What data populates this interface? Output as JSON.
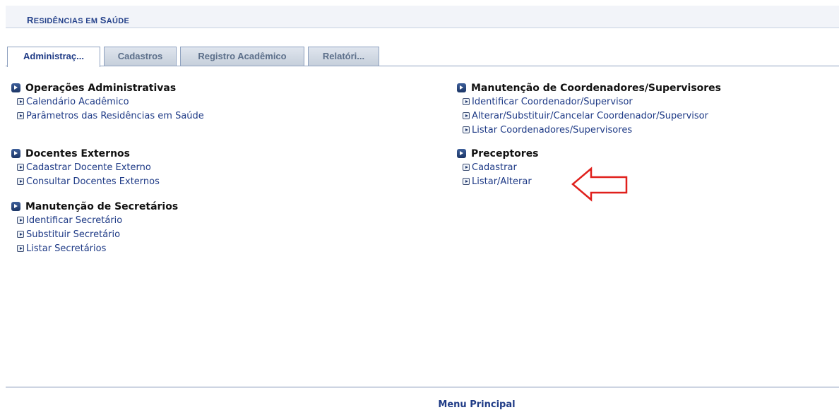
{
  "header": {
    "title_parts": [
      {
        "t": "R",
        "big": true
      },
      {
        "t": "ESIDÊNCIAS EM ",
        "big": false
      },
      {
        "t": "S",
        "big": true
      },
      {
        "t": "AÚDE",
        "big": false
      }
    ]
  },
  "tabs": [
    {
      "label": "Administraç...",
      "active": true
    },
    {
      "label": "Cadastros",
      "active": false
    },
    {
      "label": "Registro Acadêmico",
      "active": false
    },
    {
      "label": "Relatóri...",
      "active": false
    }
  ],
  "sections": {
    "operacoes": {
      "title": "Operações Administrativas",
      "items": [
        "Calendário Acadêmico",
        "Parâmetros das Residências em Saúde"
      ]
    },
    "docentes": {
      "title": "Docentes Externos",
      "items": [
        "Cadastrar Docente Externo",
        "Consultar Docentes Externos"
      ]
    },
    "secretarios": {
      "title": "Manutenção de Secretários",
      "items": [
        "Identificar Secretário",
        "Substituir Secretário",
        "Listar Secretários"
      ]
    },
    "coordenadores": {
      "title": "Manutenção de Coordenadores/Supervisores",
      "items": [
        "Identificar Coordenador/Supervisor",
        "Alterar/Substituir/Cancelar Coordenador/Supervisor",
        "Listar Coordenadores/Supervisores"
      ]
    },
    "preceptores": {
      "title": "Preceptores",
      "items": [
        "Cadastrar",
        "Listar/Alterar"
      ]
    }
  },
  "footer": {
    "link": "Menu Principal"
  },
  "colors": {
    "link": "#1e3a86",
    "annotation_arrow": "#e0201c"
  }
}
